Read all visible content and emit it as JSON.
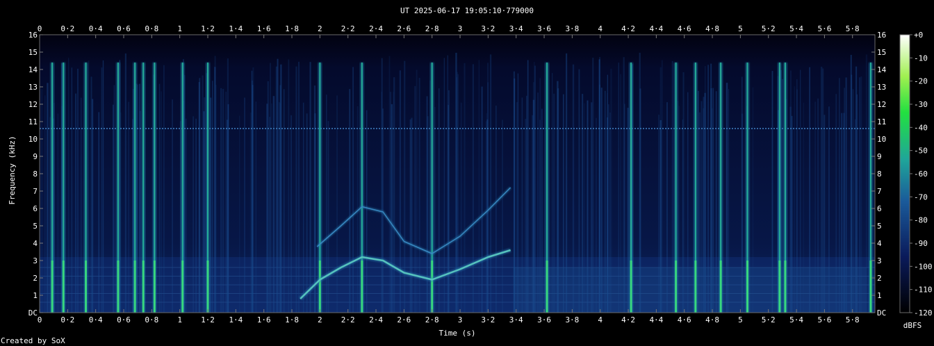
{
  "chart_data": {
    "type": "heatmap",
    "title": "UT 2025-06-17 19:05:10·779000",
    "xlabel": "Time (s)",
    "ylabel": "Frequency (kHz)",
    "xlim": [
      0,
      5.96
    ],
    "ylim": [
      0,
      16
    ],
    "x_ticks": [
      "0",
      "0·2",
      "0·4",
      "0·6",
      "0·8",
      "1",
      "1·2",
      "1·4",
      "1·6",
      "1·8",
      "2",
      "2·2",
      "2·4",
      "2·6",
      "2·8",
      "3",
      "3·2",
      "3·4",
      "3·6",
      "3·8",
      "4",
      "4·2",
      "4·4",
      "4·6",
      "4·8",
      "5",
      "5·2",
      "5·4",
      "5·6",
      "5·8"
    ],
    "x_tick_values": [
      0,
      0.2,
      0.4,
      0.6,
      0.8,
      1,
      1.2,
      1.4,
      1.6,
      1.8,
      2,
      2.2,
      2.4,
      2.6,
      2.8,
      3,
      3.2,
      3.4,
      3.6,
      3.8,
      4,
      4.2,
      4.4,
      4.6,
      4.8,
      5,
      5.2,
      5.4,
      5.6,
      5.8
    ],
    "y_ticks": [
      "DC",
      "1",
      "2",
      "3",
      "4",
      "5",
      "6",
      "7",
      "8",
      "9",
      "10",
      "11",
      "12",
      "13",
      "14",
      "15",
      "16"
    ],
    "y_tick_values": [
      0,
      1,
      2,
      3,
      4,
      5,
      6,
      7,
      8,
      9,
      10,
      11,
      12,
      13,
      14,
      15,
      16
    ],
    "colorbar": {
      "label": "dBFS",
      "ticks": [
        "+0",
        "-10",
        "-20",
        "-30",
        "-40",
        "-50",
        "-60",
        "-70",
        "-80",
        "-90",
        "-100",
        "-110",
        "-120"
      ],
      "tick_values": [
        0,
        -10,
        -20,
        -30,
        -40,
        -50,
        -60,
        -70,
        -80,
        -90,
        -100,
        -110,
        -120
      ],
      "range": [
        -120,
        0
      ]
    },
    "impulses_s": [
      0.09,
      0.17,
      0.33,
      0.56,
      0.68,
      0.74,
      0.82,
      1.02,
      1.2,
      2.0,
      2.3,
      2.8,
      3.62,
      4.22,
      4.54,
      4.68,
      4.86,
      5.05,
      5.28,
      5.32,
      5.93
    ],
    "tone_khz": 10.6,
    "chirps": [
      {
        "t": [
          1.86,
          2.0,
          2.15,
          2.3,
          2.45,
          2.6,
          2.8,
          3.0,
          3.2,
          3.36
        ],
        "f": [
          0.8,
          1.9,
          2.6,
          3.2,
          3.0,
          2.3,
          1.9,
          2.5,
          3.2,
          3.6
        ]
      },
      {
        "t": [
          1.98,
          2.15,
          2.3,
          2.45,
          2.6,
          2.8,
          3.0,
          3.2,
          3.36
        ],
        "f": [
          3.8,
          5.0,
          6.1,
          5.8,
          4.1,
          3.4,
          4.4,
          5.9,
          7.2
        ]
      }
    ]
  },
  "credit": "Created by SoX"
}
